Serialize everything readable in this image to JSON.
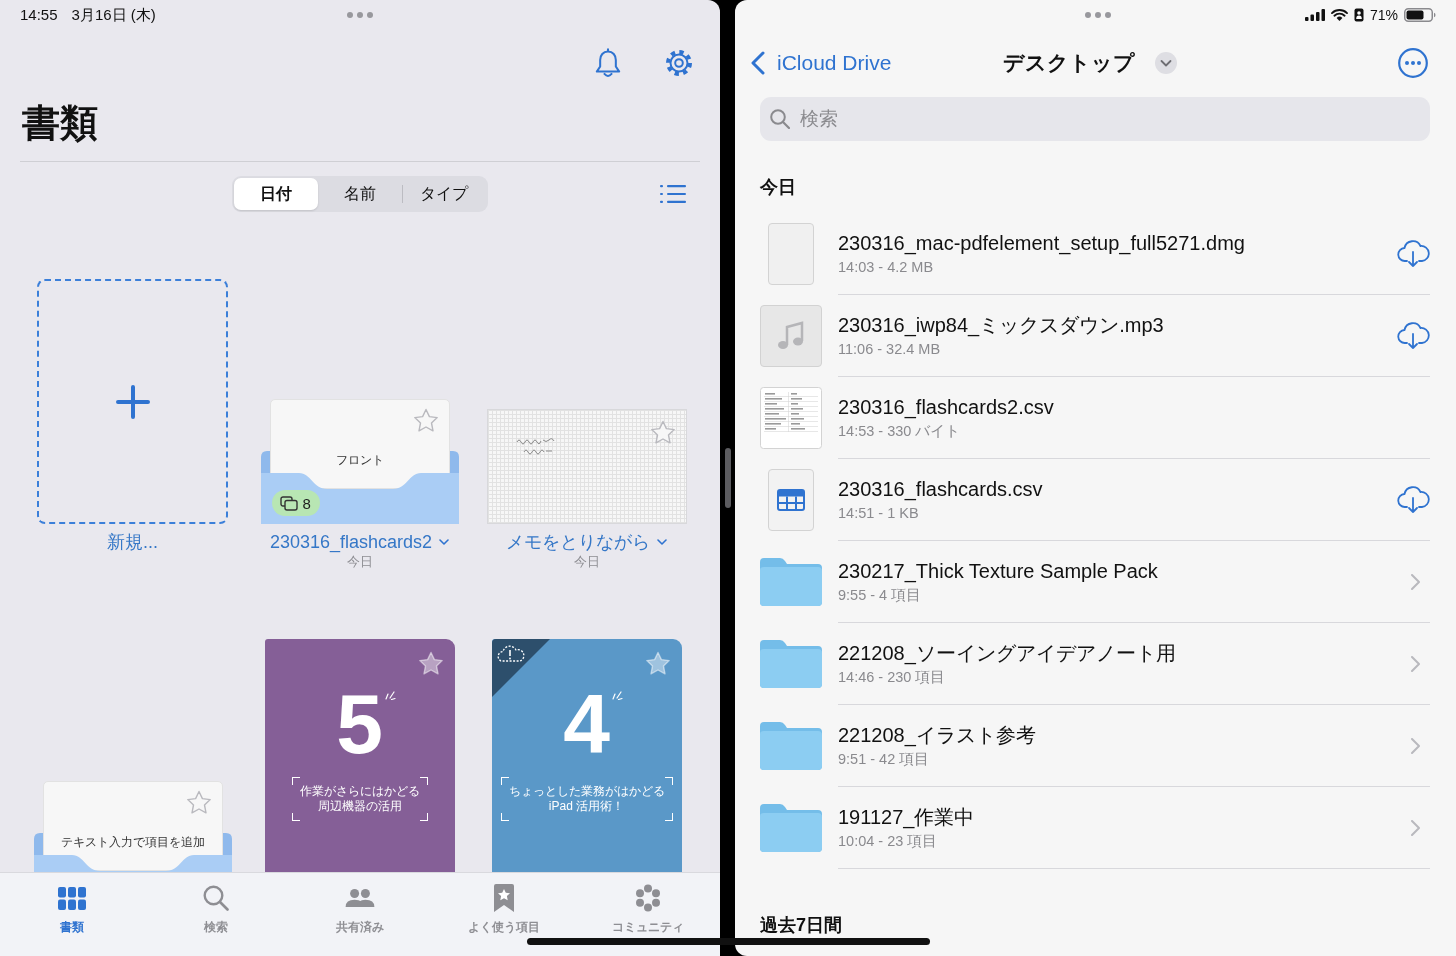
{
  "left_pane": {
    "status_bar": {
      "time": "14:55",
      "date": "3月16日 (木)"
    },
    "title": "書類",
    "sort_segments": [
      {
        "label": "日付",
        "selected": true
      },
      {
        "label": "名前",
        "selected": false
      },
      {
        "label": "タイプ",
        "selected": false
      }
    ],
    "documents": [
      {
        "kind": "new",
        "label": "新規..."
      },
      {
        "kind": "flashcards",
        "name": "230316_flashcards2",
        "date": "今日",
        "card_text": "フロント",
        "card_count": "8",
        "favorite": false,
        "downloaded": true
      },
      {
        "kind": "note",
        "name": "メモをとりながら",
        "date": "今日",
        "favorite": false,
        "downloaded": true
      },
      {
        "kind": "flashcards",
        "card_text": "テキスト入力で項目を追加",
        "favorite": false,
        "downloaded": true
      },
      {
        "kind": "book",
        "color": "#855f97",
        "number": "5",
        "subtitle": [
          "作業がさらにはかどる",
          "周辺機器の活用"
        ],
        "favorite": false,
        "downloaded": true
      },
      {
        "kind": "book",
        "color": "#5a98c8",
        "number": "4",
        "subtitle": [
          "ちょっとした業務がはかどる",
          "iPad 活用術！"
        ],
        "favorite": false,
        "downloaded": false
      }
    ],
    "tab_bar": [
      {
        "label": "書類",
        "selected": true
      },
      {
        "label": "検索",
        "selected": false
      },
      {
        "label": "共有済み",
        "selected": false
      },
      {
        "label": "よく使う項目",
        "selected": false
      },
      {
        "label": "コミュニティ",
        "selected": false
      }
    ]
  },
  "right_pane": {
    "status_bar": {
      "battery": "71%"
    },
    "nav": {
      "back": "iCloud Drive",
      "title": "デスクトップ"
    },
    "search": {
      "placeholder": "検索"
    },
    "sections": [
      {
        "title": "今日",
        "items": [
          {
            "kind": "blank_file",
            "name": "230316_mac-pdfelement_setup_full5271.dmg",
            "meta": "14:03 - 4.2 MB",
            "downloaded": false
          },
          {
            "kind": "audio_file",
            "name": "230316_iwp84_ミックスダウン.mp3",
            "meta": "11:06 - 32.4 MB",
            "downloaded": false
          },
          {
            "kind": "table_preview_file",
            "name": "230316_flashcards2.csv",
            "meta": "14:53 - 330 バイト",
            "downloaded": true
          },
          {
            "kind": "spreadsheet_file",
            "name": "230316_flashcards.csv",
            "meta": "14:51 - 1 KB",
            "downloaded": false
          },
          {
            "kind": "folder",
            "name": "230217_Thick Texture Sample Pack",
            "meta": "9:55 - 4 項目"
          },
          {
            "kind": "folder",
            "name": "221208_ソーイングアイデアノート用",
            "meta": "14:46 - 230 項目"
          },
          {
            "kind": "folder",
            "name": "221208_イラスト参考",
            "meta": "9:51 - 42 項目"
          },
          {
            "kind": "folder",
            "name": "191127_作業中",
            "meta": "10:04 - 23 項目"
          }
        ]
      },
      {
        "title": "過去7日間"
      }
    ]
  }
}
